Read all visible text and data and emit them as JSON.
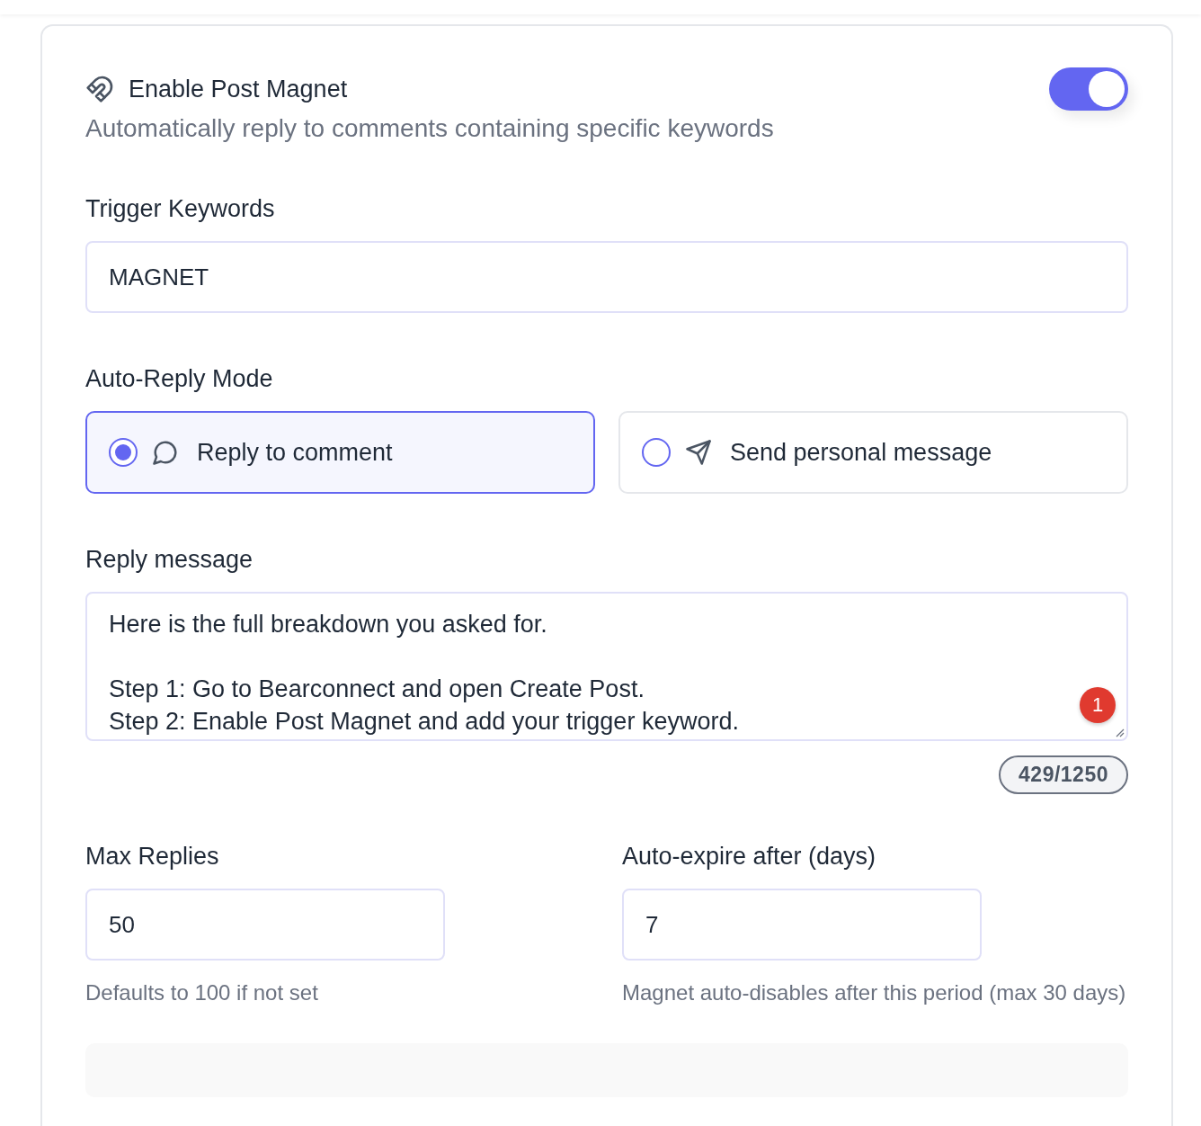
{
  "header": {
    "title": "Enable Post Magnet",
    "enabled": true,
    "description": "Automatically reply to comments containing specific keywords"
  },
  "trigger_keywords": {
    "label": "Trigger Keywords",
    "value": "MAGNET"
  },
  "auto_reply_mode": {
    "label": "Auto-Reply Mode",
    "options": [
      {
        "kind": "comment",
        "label": "Reply to comment",
        "selected": true
      },
      {
        "kind": "message",
        "label": "Send personal message",
        "selected": false
      }
    ]
  },
  "reply_message": {
    "label": "Reply message",
    "paragraphs": [
      [
        "Here is the full breakdown you asked for."
      ],
      [
        "Step 1: Go to Bearconnect and open Create Post.",
        "Step 2: Enable Post Magnet and add your trigger keyword."
      ]
    ],
    "badge": "1",
    "counter": "429/1250"
  },
  "limits": [
    {
      "label": "Max Replies",
      "value": "50",
      "hint": "Defaults to 100 if not set"
    },
    {
      "label": "Auto-expire after (days)",
      "value": "7",
      "hint": "Magnet auto-disables after this period (max 30 days)"
    }
  ]
}
